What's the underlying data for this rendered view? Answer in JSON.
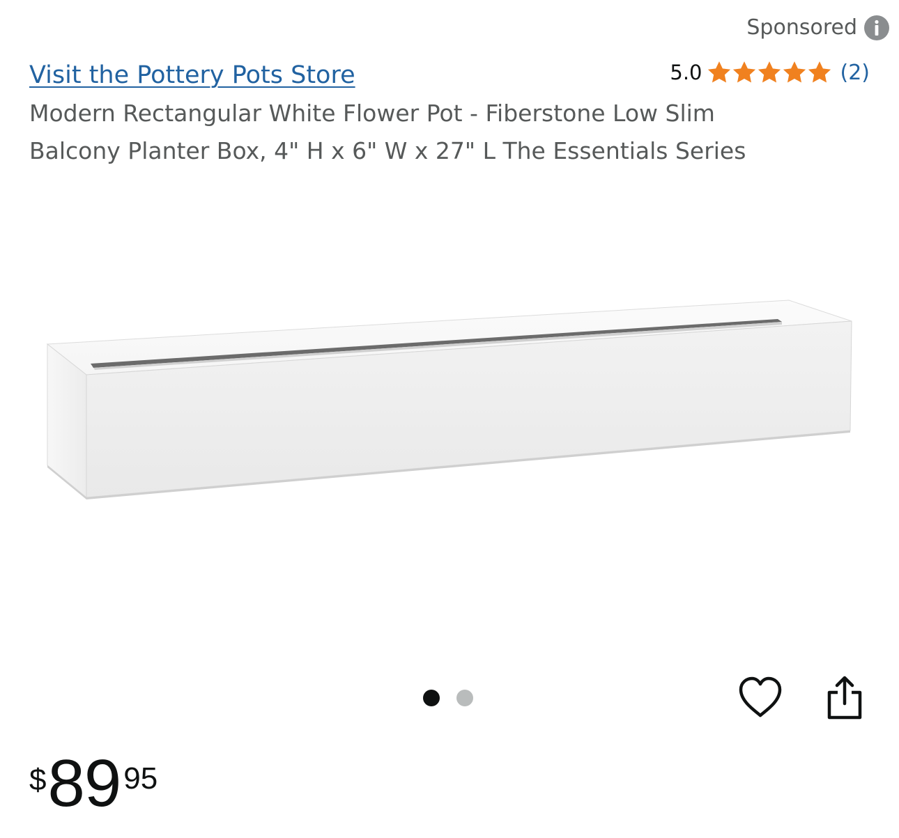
{
  "sponsored": {
    "label": "Sponsored",
    "icon": "info-icon"
  },
  "store": {
    "link_text": "Visit the Pottery Pots Store"
  },
  "rating": {
    "value": "5.0",
    "stars": 5,
    "count": "(2)",
    "star_color": "#f0811f"
  },
  "product": {
    "title": "Modern Rectangular White Flower Pot - Fiberstone Low Slim Balcony Planter Box, 4\" H x 6\" W x 27\" L The Essentials Series",
    "image_description_icon": "planter-image"
  },
  "carousel": {
    "total_images": 2,
    "active_index": 0
  },
  "actions": {
    "wishlist_icon": "heart-icon",
    "share_icon": "share-icon"
  },
  "price": {
    "symbol": "$",
    "whole": "89",
    "fraction": "95"
  },
  "colors": {
    "link": "#2162a1",
    "text_secondary": "#565959",
    "text_primary": "#0f1111"
  }
}
